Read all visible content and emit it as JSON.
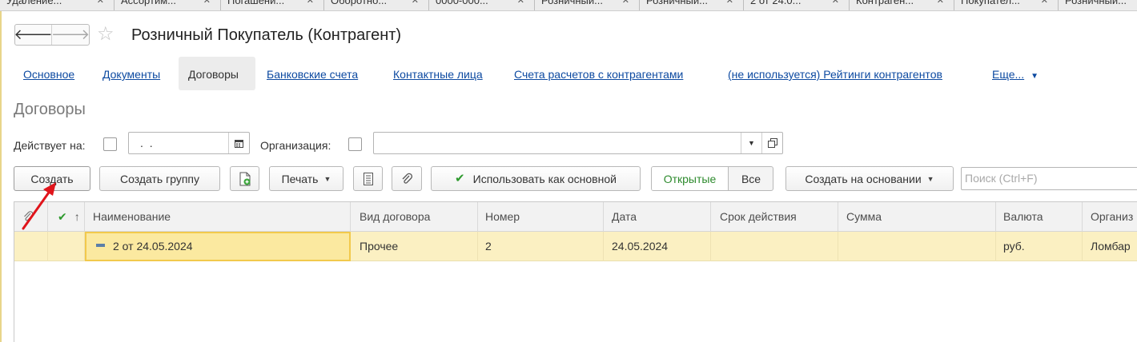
{
  "tabs": [
    {
      "label": "Удаление..."
    },
    {
      "label": "Ассортим..."
    },
    {
      "label": "Погашени..."
    },
    {
      "label": "Оборотно..."
    },
    {
      "label": "0000-000..."
    },
    {
      "label": "Розничный..."
    },
    {
      "label": "Розничный..."
    },
    {
      "label": "2 от 24.0..."
    },
    {
      "label": "Контраген..."
    },
    {
      "label": "Покупател..."
    },
    {
      "label": "Розничный..."
    }
  ],
  "header": {
    "title": "Розничный Покупатель (Контрагент)"
  },
  "nav_links": [
    {
      "label": "Основное"
    },
    {
      "label": "Документы"
    },
    {
      "label": "Договоры"
    },
    {
      "label": "Банковские счета"
    },
    {
      "label": "Контактные лица"
    },
    {
      "label": "Счета расчетов с контрагентами"
    },
    {
      "label": "(не используется) Рейтинги контрагентов"
    },
    {
      "label": "Еще..."
    }
  ],
  "section_title": "Договоры",
  "filters": {
    "date_label": "Действует на:",
    "date_value": ". .",
    "org_label": "Организация:",
    "org_value": ""
  },
  "toolbar": {
    "create": "Создать",
    "create_group": "Создать группу",
    "print": "Печать",
    "use_as_main": "Использовать как основной",
    "open": "Открытые",
    "all": "Все",
    "create_based_on": "Создать на основании",
    "search_placeholder": "Поиск (Ctrl+F)"
  },
  "table": {
    "columns": [
      "Наименование",
      "Вид договора",
      "Номер",
      "Дата",
      "Срок действия",
      "Сумма",
      "Валюта",
      "Организ"
    ],
    "rows": [
      {
        "name": "2 от 24.05.2024",
        "type": "Прочее",
        "number": "2",
        "date": "24.05.2024",
        "term": "",
        "sum": "",
        "currency": "руб.",
        "org": "Ломбар"
      }
    ]
  },
  "colors": {
    "link": "#0d4aa1",
    "selected_row": "#fbf0c2",
    "focus_cell_border": "#f2c94c",
    "open_filter": "#2e8b2e",
    "annotation_arrow": "#e0141b"
  }
}
